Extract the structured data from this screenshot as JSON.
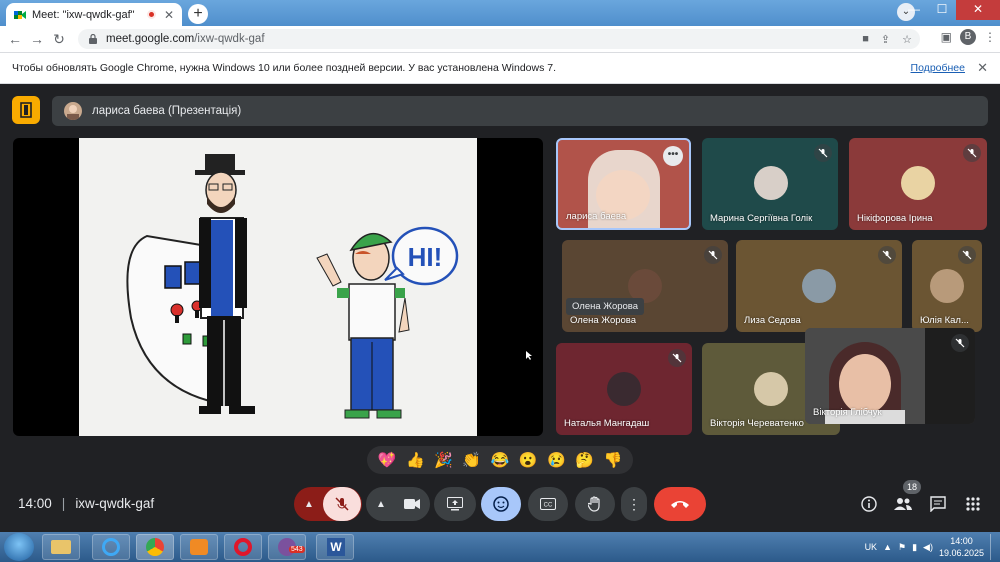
{
  "browser": {
    "tab_title": "Meet: \"ixw-qwdk-gaf\"",
    "tab_close": "✕",
    "new_tab": "+",
    "url_host": "meet.google.com",
    "url_path": "/ixw-qwdk-gaf",
    "profile_letter": "B",
    "win_min": "—",
    "win_max": "☐",
    "win_close": "✕"
  },
  "infobar": {
    "message": "Чтобы обновлять Google Chrome, нужна Windows 10 или более поздней версии. У вас установлена Windows 7.",
    "link": "Подробнее",
    "close": "✕"
  },
  "meet": {
    "presenter_label": "лариса баева (Презентація)",
    "time": "14:00",
    "separator": "|",
    "meeting_code": "ixw-qwdk-gaf",
    "participants_count": "18",
    "reactions": [
      "💖",
      "👍",
      "🎉",
      "👏",
      "😂",
      "😮",
      "😢",
      "🤔",
      "👎"
    ],
    "tooltip": "Олена Жорова"
  },
  "slide": {
    "speech_text": "HI!"
  },
  "tiles": [
    {
      "name": "лариса баева",
      "color": "#b1534a"
    },
    {
      "name": "Марина Сергіївна Голік",
      "color": "#1f4a4a"
    },
    {
      "name": "Нікіфорова Ірина",
      "color": "#8b3a3a"
    },
    {
      "name": "Олена Жорова",
      "color": "#5a4633"
    },
    {
      "name": "Лиза Седова",
      "color": "#6b5533"
    },
    {
      "name": "Юлія Кал...",
      "color": "#6b5533"
    },
    {
      "name": "Наталья Мангадаш",
      "color": "#6e2630"
    },
    {
      "name": "Вікторія Череватенко",
      "color": "#5e5a3a"
    },
    {
      "name": "Вікторія Глібчук",
      "color": "#3a3a3a"
    }
  ],
  "taskbar": {
    "viber_badge": "543",
    "lang": "UK",
    "clock_time": "14:00",
    "clock_date": "19.06.2025"
  }
}
